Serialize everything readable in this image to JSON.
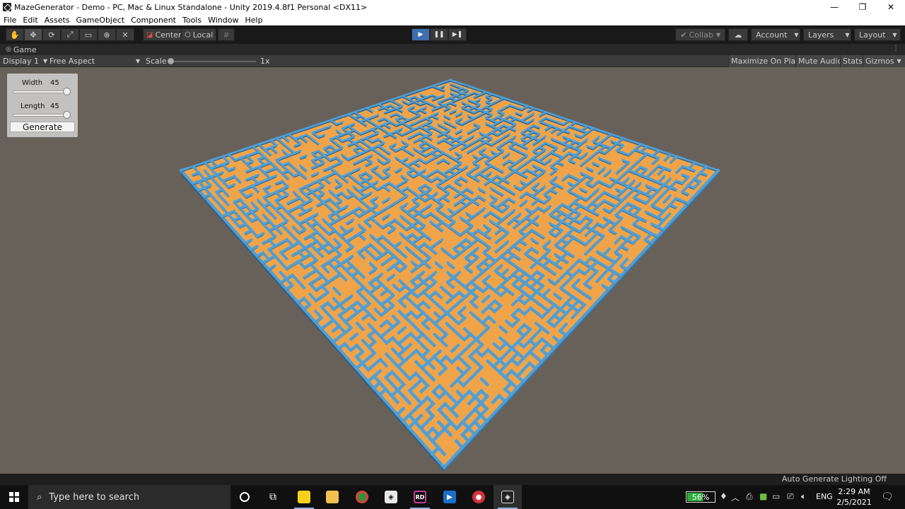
{
  "window": {
    "title": "MazeGenerator - Demo - PC, Mac & Linux Standalone - Unity 2019.4.8f1 Personal <DX11>",
    "minimize": "—",
    "maximize": "❐",
    "close": "✕"
  },
  "menu": [
    "File",
    "Edit",
    "Assets",
    "GameObject",
    "Component",
    "Tools",
    "Window",
    "Help"
  ],
  "toolbar": {
    "tools": [
      "hand-icon",
      "move-icon",
      "rotate-icon",
      "scale-icon",
      "rect-icon",
      "transform-icon",
      "custom-tool-icon"
    ],
    "active_tool": "move-icon",
    "pivot_label": "Center",
    "space_label": "Local",
    "grid_snap_icon": "grid-snap-icon",
    "play_controls": [
      "play-icon",
      "pause-icon",
      "step-icon"
    ],
    "collab_label": "Collab",
    "account_label": "Account",
    "layers_label": "Layers",
    "layout_label": "Layout"
  },
  "game_tab": {
    "label": "Game"
  },
  "game_bar": {
    "display_label": "Display 1",
    "aspect_label": "Free Aspect",
    "scale_label": "Scale",
    "scale_value": "1x",
    "maximize_label": "Maximize On Play",
    "mute_label": "Mute Audio",
    "stats_label": "Stats",
    "gizmos_label": "Gizmos"
  },
  "gui": {
    "width_label": "Width",
    "width_value": "45",
    "length_label": "Length",
    "length_value": "45",
    "generate_label": "Generate"
  },
  "status": {
    "text": "Auto Generate Lighting Off"
  },
  "taskbar": {
    "search_placeholder": "Type here to search",
    "battery_percent": "56%",
    "battery_level": 0.56,
    "language": "ENG",
    "time": "2:29 AM",
    "date": "2/5/2021"
  },
  "colors": {
    "maze_wall": "#4f9fd6",
    "maze_wall_dark": "#2d5f86",
    "maze_floor": "#f0a44a",
    "background": "#68615a",
    "play_active": "#3d6fb0"
  }
}
